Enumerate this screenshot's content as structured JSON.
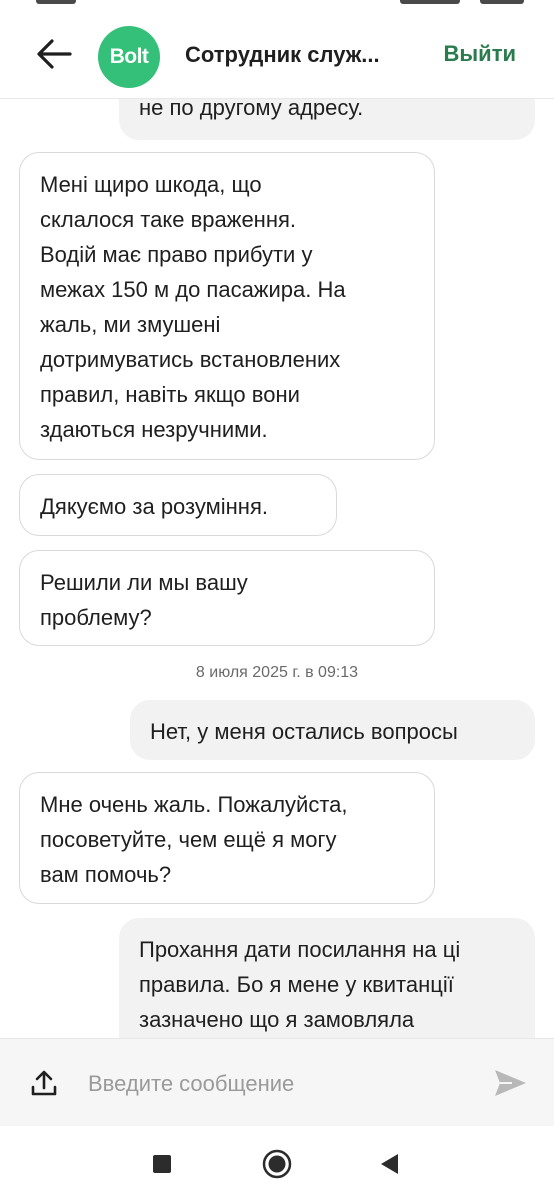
{
  "header": {
    "logo_text": "Bolt",
    "title": "Сотрудник служ...",
    "exit_label": "Выйти",
    "brand_color": "#34c079",
    "accent_color": "#2a7c4f"
  },
  "messages": [
    {
      "side": "out",
      "text": "не по другому адресу."
    },
    {
      "side": "in",
      "text": "Мені щиро шкода, що\nсклалося таке враження.\nВодій має право прибути у\nмежах 150 м до пасажира. На\nжаль, ми змушені\nдотримуватись встановлених\nправил, навіть якщо вони\nздаються незручними."
    },
    {
      "side": "in",
      "text": "Дякуємо за розуміння."
    },
    {
      "side": "in",
      "text": "Решили ли мы вашу\nпроблему?"
    },
    {
      "side": "out",
      "text": "Нет, у меня остались вопросы"
    },
    {
      "side": "in",
      "text": "Мне очень жаль. Пожалуйста,\nпосоветуйте, чем ещё я могу\nвам помочь?"
    },
    {
      "side": "out",
      "text": "Прохання дати посилання на ці\nправила. Бо я мене у квитанції\nзазначено що я замовляла"
    }
  ],
  "date_separator": "8 июля 2025 г. в 09:13",
  "composer": {
    "placeholder": "Введите сообщение",
    "value": "",
    "upload_icon": "upload-icon",
    "send_icon": "send-icon"
  },
  "navbar": {
    "icons": [
      "recents-square-icon",
      "home-circle-icon",
      "back-triangle-icon"
    ]
  }
}
